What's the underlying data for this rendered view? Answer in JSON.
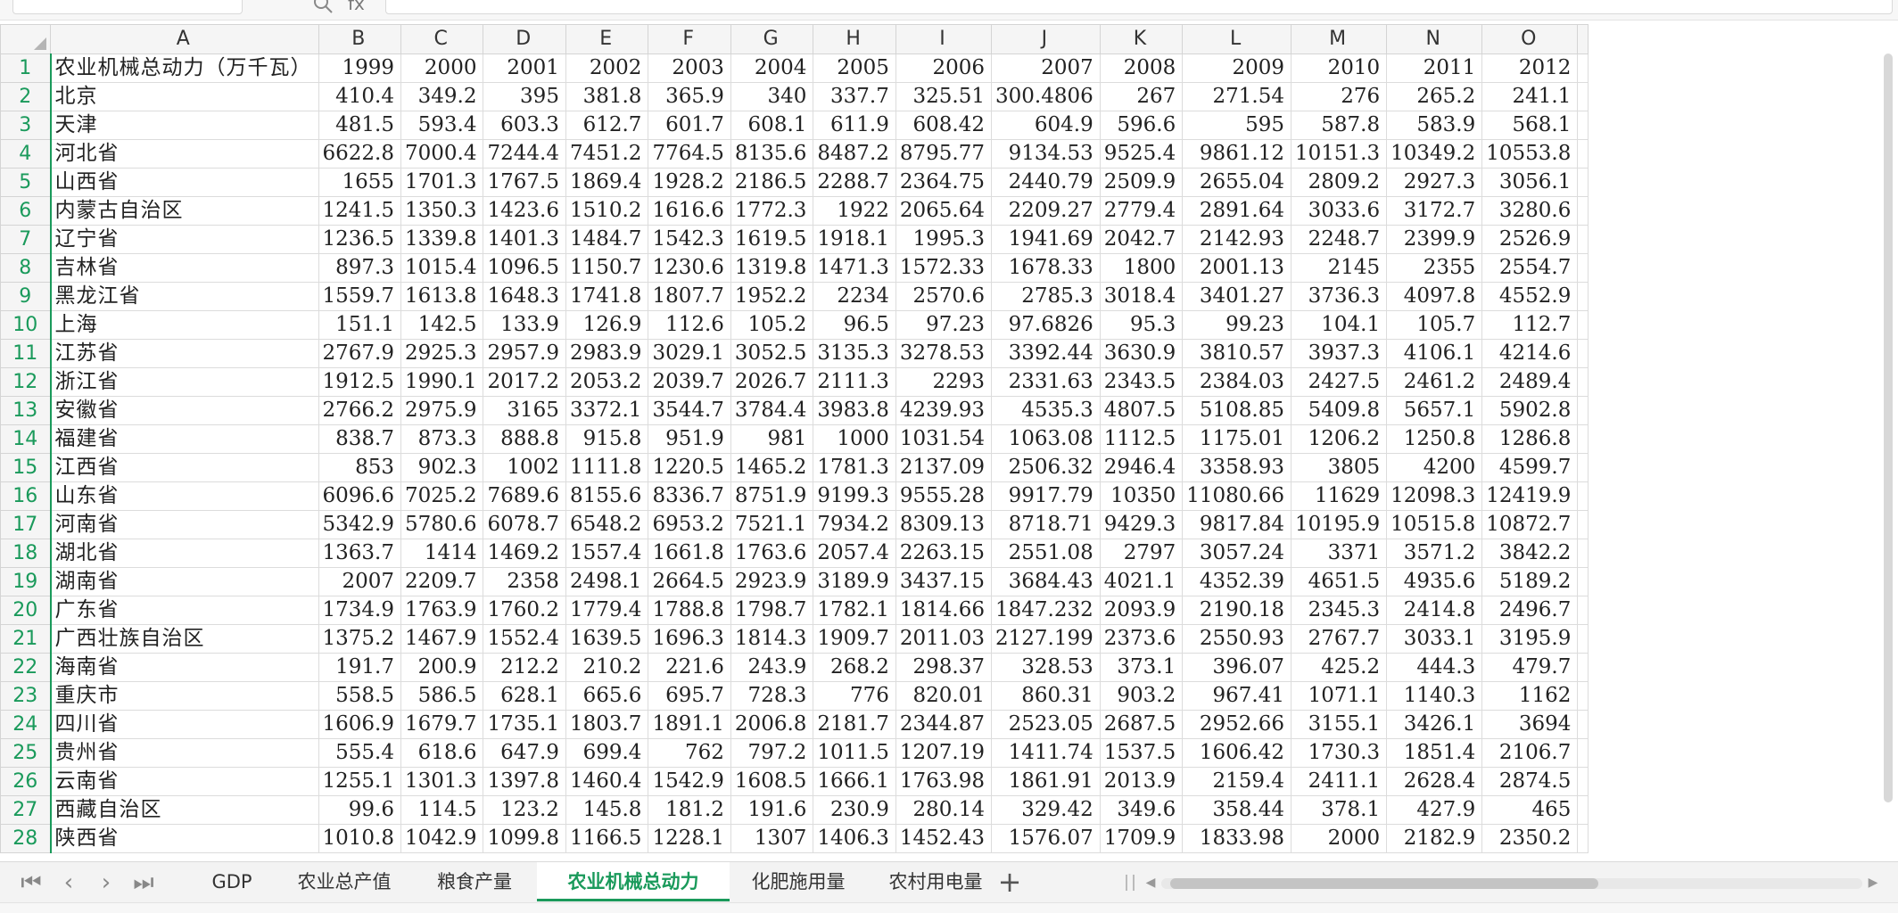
{
  "formula_bar": {
    "name_box": "",
    "fx_label": "fx",
    "value": ""
  },
  "columns": [
    "A",
    "B",
    "C",
    "D",
    "E",
    "F",
    "G",
    "H",
    "I",
    "J",
    "K",
    "L",
    "M",
    "N",
    "O"
  ],
  "header_row": [
    "农业机械总动力（万千瓦）",
    "1999",
    "2000",
    "2001",
    "2002",
    "2003",
    "2004",
    "2005",
    "2006",
    "2007",
    "2008",
    "2009",
    "2010",
    "2011",
    "2012"
  ],
  "rows": [
    [
      "北京",
      "410.4",
      "349.2",
      "395",
      "381.8",
      "365.9",
      "340",
      "337.7",
      "325.51",
      "300.4806",
      "267",
      "271.54",
      "276",
      "265.2",
      "241.1"
    ],
    [
      "天津",
      "481.5",
      "593.4",
      "603.3",
      "612.7",
      "601.7",
      "608.1",
      "611.9",
      "608.42",
      "604.9",
      "596.6",
      "595",
      "587.8",
      "583.9",
      "568.1"
    ],
    [
      "河北省",
      "6622.8",
      "7000.4",
      "7244.4",
      "7451.2",
      "7764.5",
      "8135.6",
      "8487.2",
      "8795.77",
      "9134.53",
      "9525.4",
      "9861.12",
      "10151.3",
      "10349.2",
      "10553.8"
    ],
    [
      "山西省",
      "1655",
      "1701.3",
      "1767.5",
      "1869.4",
      "1928.2",
      "2186.5",
      "2288.7",
      "2364.75",
      "2440.79",
      "2509.9",
      "2655.04",
      "2809.2",
      "2927.3",
      "3056.1"
    ],
    [
      "内蒙古自治区",
      "1241.5",
      "1350.3",
      "1423.6",
      "1510.2",
      "1616.6",
      "1772.3",
      "1922",
      "2065.64",
      "2209.27",
      "2779.4",
      "2891.64",
      "3033.6",
      "3172.7",
      "3280.6"
    ],
    [
      "辽宁省",
      "1236.5",
      "1339.8",
      "1401.3",
      "1484.7",
      "1542.3",
      "1619.5",
      "1918.1",
      "1995.3",
      "1941.69",
      "2042.7",
      "2142.93",
      "2248.7",
      "2399.9",
      "2526.9"
    ],
    [
      "吉林省",
      "897.3",
      "1015.4",
      "1096.5",
      "1150.7",
      "1230.6",
      "1319.8",
      "1471.3",
      "1572.33",
      "1678.33",
      "1800",
      "2001.13",
      "2145",
      "2355",
      "2554.7"
    ],
    [
      "黑龙江省",
      "1559.7",
      "1613.8",
      "1648.3",
      "1741.8",
      "1807.7",
      "1952.2",
      "2234",
      "2570.6",
      "2785.3",
      "3018.4",
      "3401.27",
      "3736.3",
      "4097.8",
      "4552.9"
    ],
    [
      "上海",
      "151.1",
      "142.5",
      "133.9",
      "126.9",
      "112.6",
      "105.2",
      "96.5",
      "97.23",
      "97.6826",
      "95.3",
      "99.23",
      "104.1",
      "105.7",
      "112.7"
    ],
    [
      "江苏省",
      "2767.9",
      "2925.3",
      "2957.9",
      "2983.9",
      "3029.1",
      "3052.5",
      "3135.3",
      "3278.53",
      "3392.44",
      "3630.9",
      "3810.57",
      "3937.3",
      "4106.1",
      "4214.6"
    ],
    [
      "浙江省",
      "1912.5",
      "1990.1",
      "2017.2",
      "2053.2",
      "2039.7",
      "2026.7",
      "2111.3",
      "2293",
      "2331.63",
      "2343.5",
      "2384.03",
      "2427.5",
      "2461.2",
      "2489.4"
    ],
    [
      "安徽省",
      "2766.2",
      "2975.9",
      "3165",
      "3372.1",
      "3544.7",
      "3784.4",
      "3983.8",
      "4239.93",
      "4535.3",
      "4807.5",
      "5108.85",
      "5409.8",
      "5657.1",
      "5902.8"
    ],
    [
      "福建省",
      "838.7",
      "873.3",
      "888.8",
      "915.8",
      "951.9",
      "981",
      "1000",
      "1031.54",
      "1063.08",
      "1112.5",
      "1175.01",
      "1206.2",
      "1250.8",
      "1286.8"
    ],
    [
      "江西省",
      "853",
      "902.3",
      "1002",
      "1111.8",
      "1220.5",
      "1465.2",
      "1781.3",
      "2137.09",
      "2506.32",
      "2946.4",
      "3358.93",
      "3805",
      "4200",
      "4599.7"
    ],
    [
      "山东省",
      "6096.6",
      "7025.2",
      "7689.6",
      "8155.6",
      "8336.7",
      "8751.9",
      "9199.3",
      "9555.28",
      "9917.79",
      "10350",
      "11080.66",
      "11629",
      "12098.3",
      "12419.9"
    ],
    [
      "河南省",
      "5342.9",
      "5780.6",
      "6078.7",
      "6548.2",
      "6953.2",
      "7521.1",
      "7934.2",
      "8309.13",
      "8718.71",
      "9429.3",
      "9817.84",
      "10195.9",
      "10515.8",
      "10872.7"
    ],
    [
      "湖北省",
      "1363.7",
      "1414",
      "1469.2",
      "1557.4",
      "1661.8",
      "1763.6",
      "2057.4",
      "2263.15",
      "2551.08",
      "2797",
      "3057.24",
      "3371",
      "3571.2",
      "3842.2"
    ],
    [
      "湖南省",
      "2007",
      "2209.7",
      "2358",
      "2498.1",
      "2664.5",
      "2923.9",
      "3189.9",
      "3437.15",
      "3684.43",
      "4021.1",
      "4352.39",
      "4651.5",
      "4935.6",
      "5189.2"
    ],
    [
      "广东省",
      "1734.9",
      "1763.9",
      "1760.2",
      "1779.4",
      "1788.8",
      "1798.7",
      "1782.1",
      "1814.66",
      "1847.232",
      "2093.9",
      "2190.18",
      "2345.3",
      "2414.8",
      "2496.7"
    ],
    [
      "广西壮族自治区",
      "1375.2",
      "1467.9",
      "1552.4",
      "1639.5",
      "1696.3",
      "1814.3",
      "1909.7",
      "2011.03",
      "2127.199",
      "2373.6",
      "2550.93",
      "2767.7",
      "3033.1",
      "3195.9"
    ],
    [
      "海南省",
      "191.7",
      "200.9",
      "212.2",
      "210.2",
      "221.6",
      "243.9",
      "268.2",
      "298.37",
      "328.53",
      "373.1",
      "396.07",
      "425.2",
      "444.3",
      "479.7"
    ],
    [
      "重庆市",
      "558.5",
      "586.5",
      "628.1",
      "665.6",
      "695.7",
      "728.3",
      "776",
      "820.01",
      "860.31",
      "903.2",
      "967.41",
      "1071.1",
      "1140.3",
      "1162"
    ],
    [
      "四川省",
      "1606.9",
      "1679.7",
      "1735.1",
      "1803.7",
      "1891.1",
      "2006.8",
      "2181.7",
      "2344.87",
      "2523.05",
      "2687.5",
      "2952.66",
      "3155.1",
      "3426.1",
      "3694"
    ],
    [
      "贵州省",
      "555.4",
      "618.6",
      "647.9",
      "699.4",
      "762",
      "797.2",
      "1011.5",
      "1207.19",
      "1411.74",
      "1537.5",
      "1606.42",
      "1730.3",
      "1851.4",
      "2106.7"
    ],
    [
      "云南省",
      "1255.1",
      "1301.3",
      "1397.8",
      "1460.4",
      "1542.9",
      "1608.5",
      "1666.1",
      "1763.98",
      "1861.91",
      "2013.9",
      "2159.4",
      "2411.1",
      "2628.4",
      "2874.5"
    ],
    [
      "西藏自治区",
      "99.6",
      "114.5",
      "123.2",
      "145.8",
      "181.2",
      "191.6",
      "230.9",
      "280.14",
      "329.42",
      "349.6",
      "358.44",
      "378.1",
      "427.9",
      "465"
    ],
    [
      "陕西省",
      "1010.8",
      "1042.9",
      "1099.8",
      "1166.5",
      "1228.1",
      "1307",
      "1406.3",
      "1452.43",
      "1576.07",
      "1709.9",
      "1833.98",
      "2000",
      "2182.9",
      "2350.2"
    ]
  ],
  "sheet_tabs": [
    {
      "label": "GDP",
      "active": false
    },
    {
      "label": "农业总产值",
      "active": false
    },
    {
      "label": "粮食产量",
      "active": false
    },
    {
      "label": "农业机械总动力",
      "active": true
    },
    {
      "label": "化肥施用量",
      "active": false
    },
    {
      "label": "农村用电量",
      "active": false
    }
  ],
  "nav_icons": [
    "first-sheet-icon",
    "prev-sheet-icon",
    "next-sheet-icon",
    "last-sheet-icon"
  ],
  "accent_color": "#1a9a5b"
}
